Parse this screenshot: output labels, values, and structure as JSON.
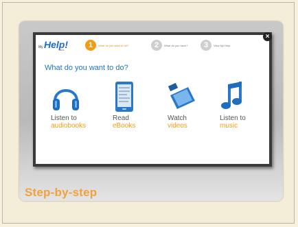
{
  "logo": {
    "my": "My",
    "help": "Help!",
    "beta": "BETA"
  },
  "steps": [
    {
      "number": "1",
      "label": "What do you want to do?"
    },
    {
      "number": "2",
      "label": "What do you have?"
    },
    {
      "number": "3",
      "label": "View My Help"
    }
  ],
  "question": "What do you want to do?",
  "options": [
    {
      "line1": "Listen to",
      "line2": "audiobooks",
      "icon": "headphones-icon"
    },
    {
      "line1": "Read",
      "line2": "eBooks",
      "icon": "ereader-icon"
    },
    {
      "line1": "Watch",
      "line2": "videos",
      "icon": "film-icon"
    },
    {
      "line1": "Listen to",
      "line2": "music",
      "icon": "music-note-icon"
    }
  ],
  "close_label": "×",
  "caption": "Step-by-step",
  "colors": {
    "accent_orange": "#f29b17",
    "accent_blue": "#2075c7",
    "frame_bg": "#f6f0dc"
  }
}
